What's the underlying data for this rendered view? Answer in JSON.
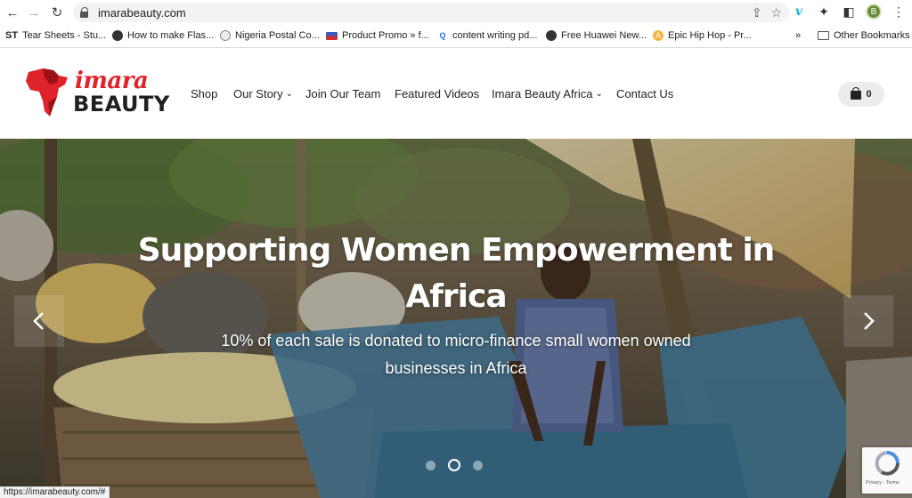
{
  "browser": {
    "url": "imarabeauty.com",
    "bookmarks": [
      {
        "label": "Tear Sheets - Stu...",
        "icon": "st-icon"
      },
      {
        "label": "How to make Flas...",
        "icon": "globe-icon"
      },
      {
        "label": "Nigeria Postal Co...",
        "icon": "postal-icon"
      },
      {
        "label": "Product Promo » f...",
        "icon": "flag-icon"
      },
      {
        "label": "content writing pd...",
        "icon": "search-icon"
      },
      {
        "label": "Free Huawei New...",
        "icon": "globe-icon"
      },
      {
        "label": "Epic Hip Hop - Pr...",
        "icon": "music-icon"
      }
    ],
    "bookmark_st": "ST",
    "overflow": "»",
    "other_bookmarks": "Other Bookmarks",
    "profile_initial": "B",
    "status_url": "https://imarabeauty.com/#"
  },
  "site": {
    "logo": {
      "line1": "imara",
      "line2": "BEAUTY"
    },
    "menu": [
      {
        "label": "Shop",
        "has_dropdown": false
      },
      {
        "label": "Our Story",
        "has_dropdown": true
      },
      {
        "label": "Join Our Team",
        "has_dropdown": false
      },
      {
        "label": "Featured Videos",
        "has_dropdown": false
      },
      {
        "label": "Imara Beauty Africa",
        "has_dropdown": true
      },
      {
        "label": "Contact Us",
        "has_dropdown": false
      }
    ],
    "cart_count": "0"
  },
  "hero": {
    "title": "Supporting Women Empowerment in Africa",
    "subtitle": "10% of each sale is donated to micro-finance small women owned businesses in Africa",
    "slide_count": 3,
    "active_slide": 2
  },
  "recaptcha": {
    "links": "Privacy - Terms"
  },
  "colors": {
    "brand_red": "#e0232a",
    "brand_dark": "#231f20",
    "accent_blue": "#1ab7ea"
  }
}
